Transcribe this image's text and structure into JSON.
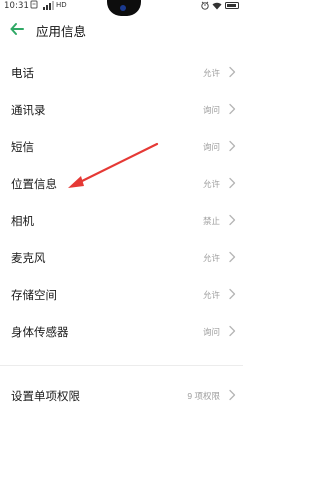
{
  "status_bar": {
    "time": "10:31",
    "notification_icon": "notification-icon",
    "network_text": "≡¹.Ⅰ",
    "hd_label": "HD",
    "icons": [
      "alarm-icon",
      "wifi-icon",
      "battery-icon"
    ]
  },
  "header": {
    "back_icon": "back-arrow-icon",
    "title": "应用信息",
    "accent_color": "#2fa865"
  },
  "permissions": [
    {
      "label": "电话",
      "value": "允许"
    },
    {
      "label": "通讯录",
      "value": "询问"
    },
    {
      "label": "短信",
      "value": "询问"
    },
    {
      "label": "位置信息",
      "value": "允许"
    },
    {
      "label": "相机",
      "value": "禁止"
    },
    {
      "label": "麦克风",
      "value": "允许"
    },
    {
      "label": "存储空间",
      "value": "允许"
    },
    {
      "label": "身体传感器",
      "value": "询问"
    }
  ],
  "single_permissions": {
    "label": "设置单项权限",
    "value": "9 项权限"
  },
  "annotation": {
    "color": "#e53935",
    "icon": "red-arrow-annotation"
  }
}
